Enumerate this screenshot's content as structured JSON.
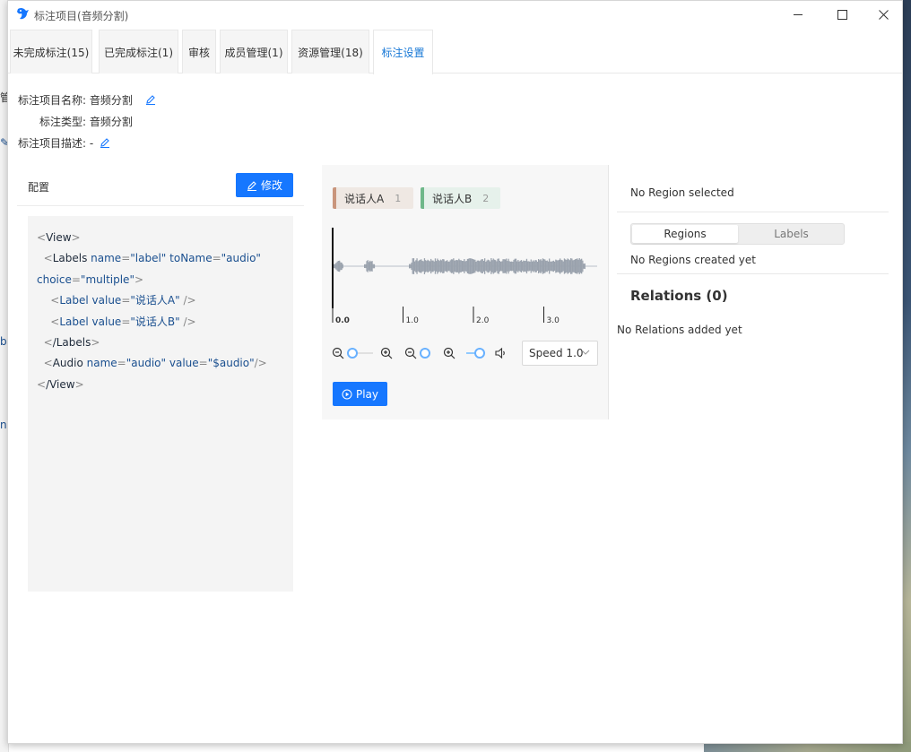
{
  "window": {
    "title": "标注项目(音频分割)"
  },
  "tabs": [
    {
      "label": "未完成标注(15)"
    },
    {
      "label": "已完成标注(1)"
    },
    {
      "label": "审核"
    },
    {
      "label": "成员管理(1)"
    },
    {
      "label": "资源管理(18)"
    },
    {
      "label": "标注设置",
      "active": true
    }
  ],
  "project": {
    "name_label": "标注项目名称:",
    "name_value": "音频分割",
    "type_label": "标注类型:",
    "type_value": "音频分割",
    "desc_label": "标注项目描述:",
    "desc_value": "-"
  },
  "config": {
    "title": "配置",
    "modify_label": "修改",
    "code": {
      "view_open": "View",
      "labels_tag": "Labels",
      "attr_name": "name",
      "val_label": "\"label\"",
      "attr_toname": "toName",
      "val_audio": "\"audio\"",
      "attr_choice": "choice",
      "val_multiple": "\"multiple\"",
      "label_tag": "Label",
      "attr_value": "value",
      "val_speaker_a": "\"说话人A\"",
      "val_speaker_b": "\"说话人B\"",
      "labels_close": "/Labels",
      "audio_tag": "Audio",
      "val_audio_var": "\"$audio\"",
      "view_close": "/View"
    }
  },
  "audio": {
    "labels": [
      {
        "name": "说话人A",
        "hotkey": "1",
        "color": "#c9957c"
      },
      {
        "name": "说话人B",
        "hotkey": "2",
        "color": "#6fb88a"
      }
    ],
    "timeline": [
      "0.0",
      "1.0",
      "2.0",
      "3.0"
    ],
    "speed_label": "Speed 1.0",
    "play_label": "Play"
  },
  "sidebar": {
    "no_region": "No Region selected",
    "tab_regions": "Regions",
    "tab_labels": "Labels",
    "no_regions": "No Regions created yet",
    "relations_title": "Relations (0)",
    "no_relations": "No Relations added yet"
  },
  "colors": {
    "primary": "#1677ff",
    "tab_active": "#1677d6"
  }
}
